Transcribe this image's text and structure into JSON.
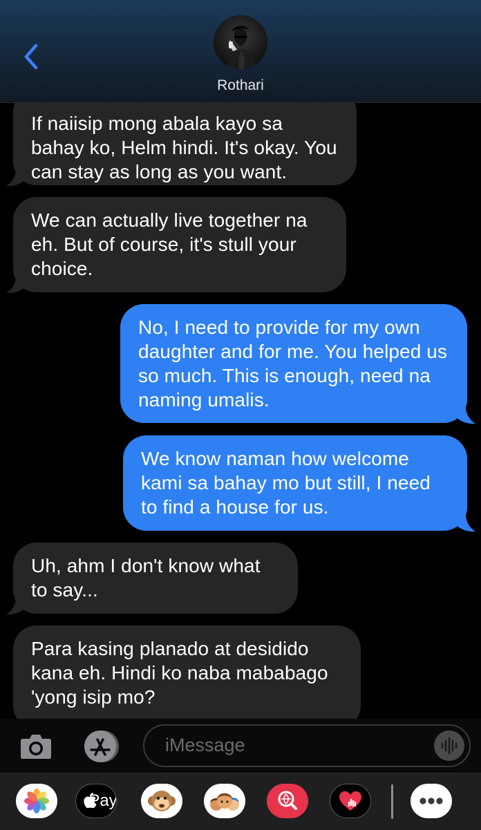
{
  "header": {
    "contact_name": "Rothari"
  },
  "messages": [
    {
      "sender": "them",
      "text": "If naiisip mong abala kayo sa bahay ko, Helm hindi. It's okay. You can stay as long as you want."
    },
    {
      "sender": "them",
      "text": "We can actually live together na eh. But of course, it's stull your choice."
    },
    {
      "sender": "me",
      "text": "No, I need to provide for my own daughter and for me. You helped us so much. This is enough, need na naming umalis."
    },
    {
      "sender": "me",
      "text": "We know naman how welcome kami sa bahay mo but still, I need to find a house for us."
    },
    {
      "sender": "them",
      "text": "Uh, ahm I don't know what to say..."
    },
    {
      "sender": "them",
      "text": "Para kasing planado at desidido kana eh. Hindi ko naba mababago 'yong isip mo?"
    }
  ],
  "input": {
    "placeholder": "iMessage"
  },
  "drawer": {
    "apps": [
      {
        "icon": "photos-icon"
      },
      {
        "icon": "apple-pay-icon",
        "label": "Pay"
      },
      {
        "icon": "monkey-memoji-icon"
      },
      {
        "icon": "memoji-stickers-icon"
      },
      {
        "icon": "image-search-icon"
      },
      {
        "icon": "digital-touch-icon"
      },
      {
        "icon": "more-icon"
      }
    ]
  },
  "colors": {
    "sent_bubble": "#2f80f2",
    "received_bubble": "#262628",
    "accent": "#3b82f6"
  }
}
